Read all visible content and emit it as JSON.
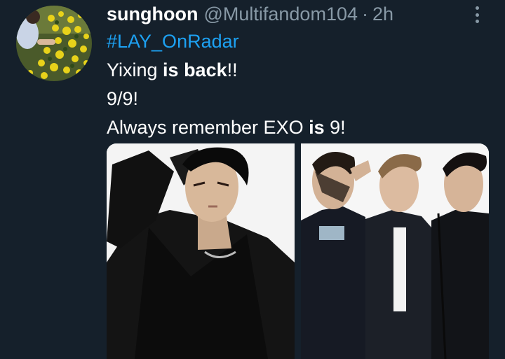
{
  "tweet": {
    "author": {
      "display_name": "sunghoon",
      "handle": "@Multifandom104"
    },
    "separator": "·",
    "time": "2h",
    "hashtag": "#LAY_OnRadar",
    "lines": [
      {
        "parts": [
          {
            "text": "Yixing "
          },
          {
            "text": "is back",
            "bold": true
          },
          {
            "text": "!!"
          }
        ]
      },
      {
        "parts": [
          {
            "text": "9/9!"
          }
        ]
      },
      {
        "parts": [
          {
            "text": "Always remember EXO "
          },
          {
            "text": "is",
            "bold": true
          },
          {
            "text": " 9!"
          }
        ]
      }
    ],
    "media_count": 2
  },
  "icons": {
    "more": "vertical-ellipsis-icon",
    "avatar": "flower-field-photo"
  },
  "colors": {
    "background": "#15202b",
    "text_primary": "#ffffff",
    "text_secondary": "#8899a6",
    "link": "#1da1f2"
  }
}
